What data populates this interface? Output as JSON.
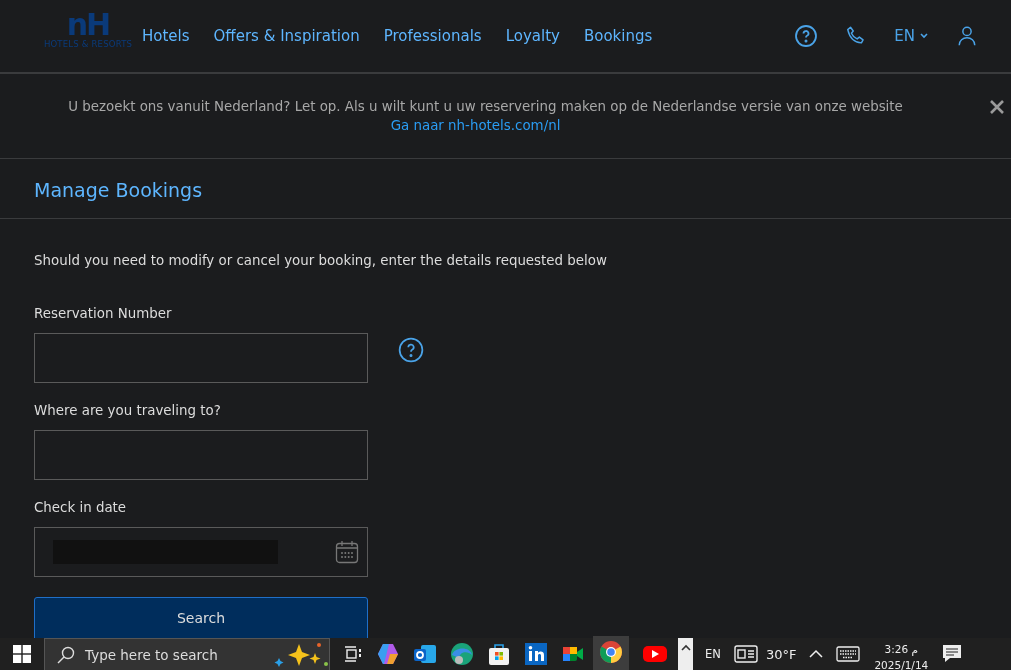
{
  "header": {
    "logo": {
      "mark": "nH",
      "tagline": "HOTELS & RESORTS"
    },
    "nav": [
      {
        "label": "Hotels"
      },
      {
        "label": "Offers & Inspiration"
      },
      {
        "label": "Professionals"
      },
      {
        "label": "Loyalty"
      },
      {
        "label": "Bookings"
      }
    ],
    "language": "EN"
  },
  "banner": {
    "message": "U bezoekt ons vanuit Nederland? Let op. Als u wilt kunt u uw reservering maken op de Nederlandse versie van onze website",
    "link": "Ga naar nh-hotels.com/nl"
  },
  "page_title": "Manage Bookings",
  "intro": "Should you need to modify or cancel your booking, enter the details requested below",
  "fields": [
    {
      "label": "Reservation Number",
      "kind": "text",
      "help": true
    },
    {
      "label": "Where are you traveling to?",
      "kind": "text",
      "help": false
    },
    {
      "label": "Check in date",
      "kind": "date",
      "help": false
    }
  ],
  "submit": "Search",
  "taskbar": {
    "search_placeholder": "Type here to search",
    "language": "EN",
    "weather": "30°F",
    "time": "3:26 م",
    "date": "2025/1/14"
  }
}
